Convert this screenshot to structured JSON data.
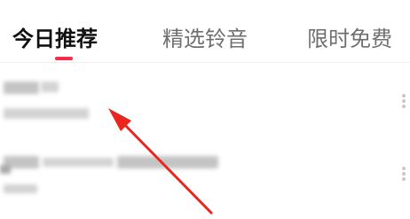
{
  "tabs": [
    {
      "label": "今日推荐",
      "active": true
    },
    {
      "label": "精选铃音",
      "active": false
    },
    {
      "label": "限时免费",
      "active": false
    }
  ],
  "colors": {
    "accent": "#ff2b4a",
    "active_tab_text": "#111111",
    "inactive_tab_text": "#6f6f6f",
    "annotation_arrow": "#e8261e"
  },
  "list": {
    "items": [
      {
        "content": "redacted",
        "menu_icon": "more-vertical-icon"
      },
      {
        "content": "redacted",
        "menu_icon": "more-vertical-icon"
      }
    ]
  },
  "annotation": {
    "type": "arrow",
    "color": "#e8261e",
    "points_to": "list-item-1"
  }
}
